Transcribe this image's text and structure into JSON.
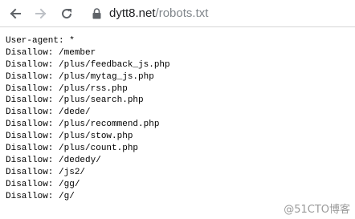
{
  "browser": {
    "url_host": "dytt8.net",
    "url_path": "/robots.txt",
    "icons": {
      "back": "arrow-left-icon",
      "forward": "arrow-right-icon",
      "reload": "reload-icon",
      "lock": "lock-icon"
    },
    "forward_enabled": false
  },
  "document": {
    "lines": [
      "User-agent: *",
      "Disallow: /member",
      "Disallow: /plus/feedback_js.php",
      "Disallow: /plus/mytag_js.php",
      "Disallow: /plus/rss.php",
      "Disallow: /plus/search.php",
      "Disallow: /dede/",
      "Disallow: /plus/recommend.php",
      "Disallow: /plus/stow.php",
      "Disallow: /plus/count.php",
      "Disallow: /dededy/",
      "Disallow: /js2/",
      "Disallow: /gg/",
      "Disallow: /g/"
    ]
  },
  "watermark": {
    "text": "@51CTO博客"
  }
}
